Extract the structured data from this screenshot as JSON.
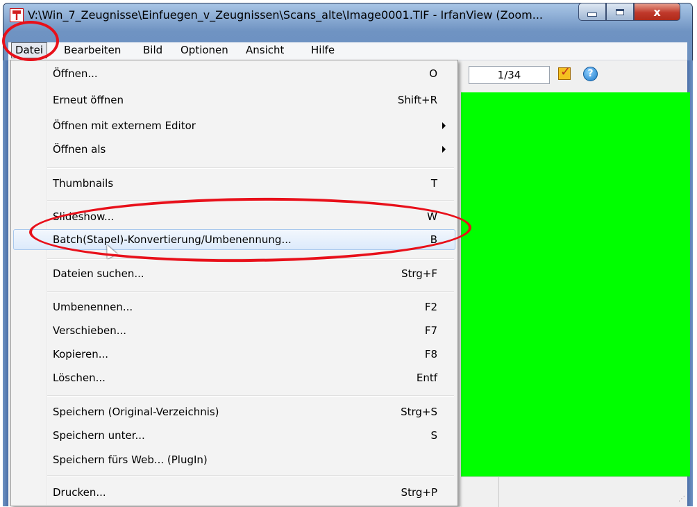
{
  "window": {
    "title": "V:\\Win_7_Zeugnisse\\Einfuegen_v_Zeugnissen\\Scans_alte\\Image0001.TIF - IrfanView (Zoom...",
    "close_glyph": "x"
  },
  "menubar": {
    "items": [
      "Datei",
      "Bearbeiten",
      "Bild",
      "Optionen",
      "Ansicht",
      "Hilfe"
    ]
  },
  "toolbar": {
    "page_counter": "1/34",
    "help_glyph": "?"
  },
  "menu": {
    "items": [
      {
        "label": "Öffnen...",
        "shortcut": "O"
      },
      {
        "label": "Erneut öffnen",
        "shortcut": "Shift+R"
      },
      {
        "label": "Öffnen mit externem Editor",
        "shortcut": ""
      },
      {
        "label": "Öffnen als",
        "shortcut": ""
      },
      {
        "label": "Thumbnails",
        "shortcut": "T"
      },
      {
        "label": "Slideshow...",
        "shortcut": "W"
      },
      {
        "label": "Batch(Stapel)-Konvertierung/Umbenennung...",
        "shortcut": "B"
      },
      {
        "label": "Dateien suchen...",
        "shortcut": "Strg+F"
      },
      {
        "label": "Umbenennen...",
        "shortcut": "F2"
      },
      {
        "label": "Verschieben...",
        "shortcut": "F7"
      },
      {
        "label": "Kopieren...",
        "shortcut": "F8"
      },
      {
        "label": "Löschen...",
        "shortcut": "Entf"
      },
      {
        "label": "Speichern (Original-Verzeichnis)",
        "shortcut": "Strg+S"
      },
      {
        "label": "Speichern unter...",
        "shortcut": "S"
      },
      {
        "label": "Speichern fürs Web... (PlugIn)",
        "shortcut": ""
      },
      {
        "label": "Drucken...",
        "shortcut": "Strg+P"
      }
    ]
  },
  "colors": {
    "image_fill": "#00ff00",
    "annotation": "#e8101a",
    "highlight": "#dceafb"
  }
}
